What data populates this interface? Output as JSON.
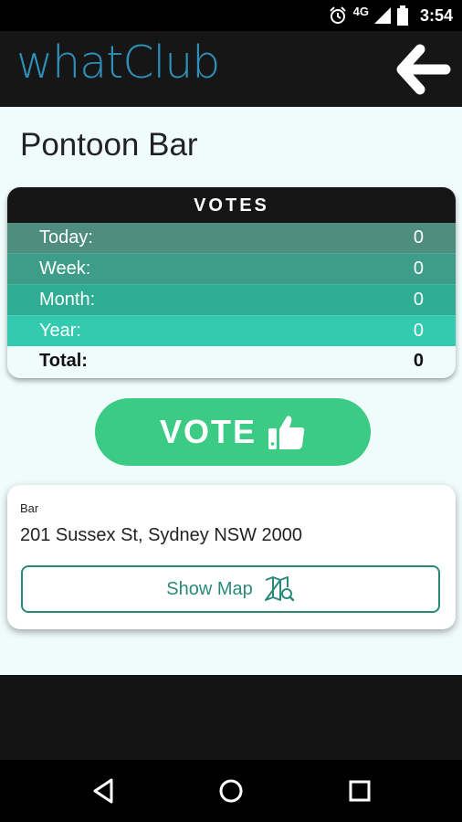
{
  "status_bar": {
    "network": "4G",
    "time": "3:54"
  },
  "app_bar": {
    "brand": "whatClub"
  },
  "venue": {
    "name": "Pontoon Bar"
  },
  "votes": {
    "header": "VOTES",
    "rows": [
      {
        "label": "Today:",
        "value": "0",
        "color": "#4f8d7e"
      },
      {
        "label": "Week:",
        "value": "0",
        "color": "#3d9d89"
      },
      {
        "label": "Month:",
        "value": "0",
        "color": "#2eac94"
      },
      {
        "label": "Year:",
        "value": "0",
        "color": "#33cbb0"
      }
    ],
    "total": {
      "label": "Total:",
      "value": "0"
    }
  },
  "vote_button": {
    "label": "VOTE",
    "color": "#3ccb84"
  },
  "info": {
    "category": "Bar",
    "address": "201 Sussex St, Sydney NSW 2000",
    "map_button": "Show Map"
  },
  "colors": {
    "brand": "#2e8fb8",
    "accent": "#2a8a7a",
    "background": "#f0fcfb"
  }
}
